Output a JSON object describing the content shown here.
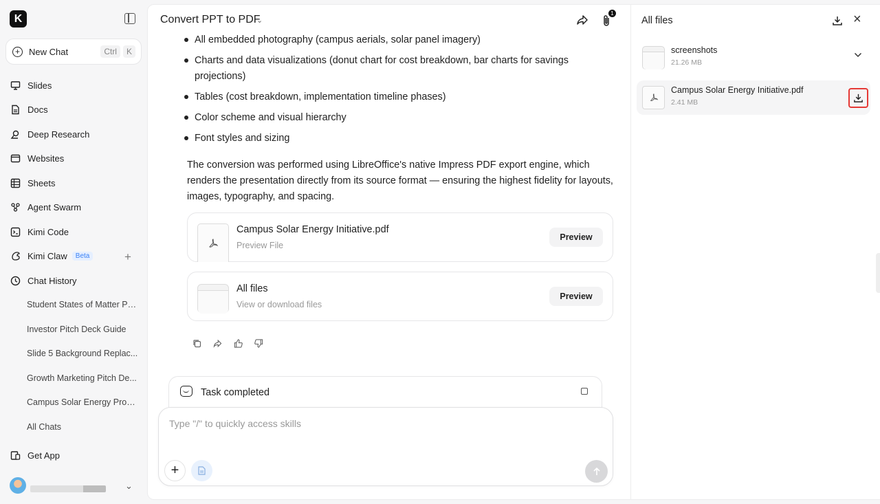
{
  "sidebar": {
    "logo_letter": "K",
    "new_chat": {
      "label": "New Chat",
      "kbd": [
        "Ctrl",
        "K"
      ]
    },
    "nav": [
      {
        "label": "Slides",
        "icon": "slides-icon"
      },
      {
        "label": "Docs",
        "icon": "docs-icon"
      },
      {
        "label": "Deep Research",
        "icon": "deep-research-icon"
      },
      {
        "label": "Websites",
        "icon": "websites-icon"
      },
      {
        "label": "Sheets",
        "icon": "sheets-icon"
      },
      {
        "label": "Agent Swarm",
        "icon": "agent-swarm-icon"
      },
      {
        "label": "Kimi Code",
        "icon": "terminal-icon"
      },
      {
        "label": "Kimi Claw",
        "icon": "claw-icon",
        "badge": "Beta"
      },
      {
        "label": "Chat History",
        "icon": "clock-icon"
      }
    ],
    "history": [
      "Student States of Matter PPT",
      "Investor Pitch Deck Guide",
      "Slide 5 Background Replac...",
      "Growth Marketing Pitch De...",
      "Campus Solar Energy Prop...",
      "All Chats"
    ],
    "get_app": "Get App"
  },
  "main": {
    "title": "Convert PPT to PDF",
    "attachment_count": "1",
    "bullets": [
      "All embedded photography (campus aerials, solar panel imagery)",
      "Charts and data visualizations (donut chart for cost breakdown, bar charts for savings projections)",
      "Tables (cost breakdown, implementation timeline phases)",
      "Color scheme and visual hierarchy",
      "Font styles and sizing"
    ],
    "paragraph": "The conversion was performed using LibreOffice's native Impress PDF export engine, which renders the presentation directly from its source format — ensuring the highest fidelity for layouts, images, typography, and spacing.",
    "cards": [
      {
        "title": "Campus Solar Energy Initiative.pdf",
        "subtitle": "Preview File",
        "button": "Preview"
      },
      {
        "title": "All files",
        "subtitle": "View or download files",
        "button": "Preview"
      }
    ],
    "task_status": "Task completed",
    "input_placeholder": "Type \"/\" to quickly access skills"
  },
  "files_panel": {
    "title": "All files",
    "items": [
      {
        "name": "screenshots",
        "size": "21.26 MB",
        "type": "folder"
      },
      {
        "name": "Campus Solar Energy Initiative.pdf",
        "size": "2.41 MB",
        "type": "pdf"
      }
    ]
  },
  "colors": {
    "accent_blue": "#3b82f6",
    "highlight_red": "#e53935"
  }
}
